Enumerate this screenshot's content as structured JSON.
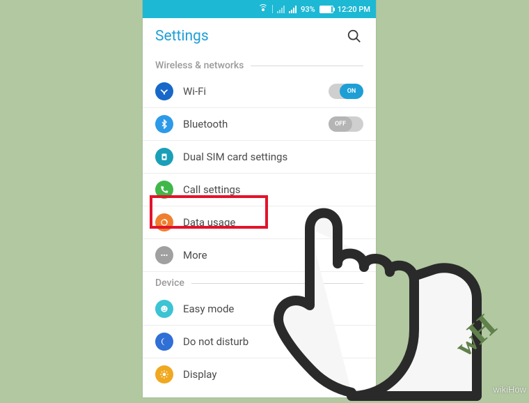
{
  "statusbar": {
    "battery_pct": "93%",
    "time": "12:20 PM"
  },
  "header": {
    "title": "Settings"
  },
  "sections": {
    "wireless": {
      "label": "Wireless & networks",
      "items": [
        {
          "id": "wifi",
          "label": "Wi-Fi",
          "icon_bg": "#1868c9",
          "toggle": "on",
          "toggle_label": "ON"
        },
        {
          "id": "bluetooth",
          "label": "Bluetooth",
          "icon_bg": "#2c9ae8",
          "toggle": "off",
          "toggle_label": "OFF"
        },
        {
          "id": "dualsim",
          "label": "Dual SIM card settings",
          "icon_bg": "#1a9fb8"
        },
        {
          "id": "call",
          "label": "Call settings",
          "icon_bg": "#3fb749"
        },
        {
          "id": "data",
          "label": "Data usage",
          "icon_bg": "#ef7f2f"
        },
        {
          "id": "more",
          "label": "More",
          "icon_bg": "#a0a0a0"
        }
      ]
    },
    "device": {
      "label": "Device",
      "items": [
        {
          "id": "easy",
          "label": "Easy mode",
          "icon_bg": "#3cc3d4"
        },
        {
          "id": "dnd",
          "label": "Do not disturb",
          "icon_bg": "#2f6fd6"
        },
        {
          "id": "display",
          "label": "Display",
          "icon_bg": "#f0a820"
        }
      ]
    }
  },
  "branding": {
    "source": "wikiHow"
  }
}
